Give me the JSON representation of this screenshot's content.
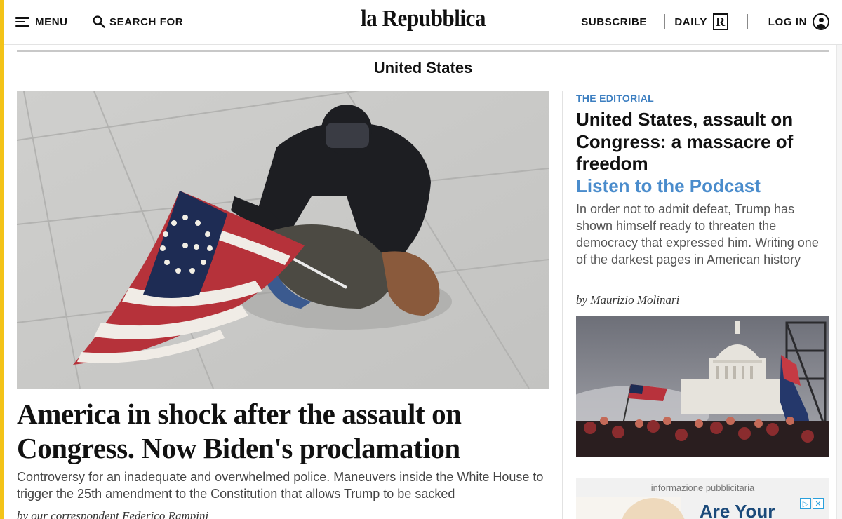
{
  "header": {
    "menu_label": "MENU",
    "search_label": "SEARCH FOR",
    "logo": "la Repubblica",
    "subscribe_label": "SUBSCRIBE",
    "daily_label": "DAILY",
    "daily_badge": "R",
    "login_label": "LOG IN"
  },
  "section": {
    "title": "United States"
  },
  "main_story": {
    "headline": "America in shock after the assault on Congress. Now Biden's proclamation",
    "summary": "Controversy for an inadequate and overwhelmed police. Maneuvers inside the White House to trigger the 25th amendment to the Constitution that allows Trump to be sacked",
    "byline": "by our correspondent Federico Rampini"
  },
  "editorial": {
    "kicker": "THE EDITORIAL",
    "title": "United States, assault on Congress: a massacre of freedom",
    "link": "Listen to the Podcast",
    "summary": "In order not to admit defeat, Trump has shown himself ready to threaten the democracy that expressed him. Writing one of the darkest pages in American history",
    "byline": "by Maurizio Molinari"
  },
  "ad": {
    "label": "informazione pubblicitaria",
    "text": "Are Your",
    "choices_icon": "adchoices-icon"
  },
  "colors": {
    "accent_yellow": "#f3c318",
    "link_blue": "#4a8ccc",
    "kicker_blue": "#3d7fc1"
  }
}
